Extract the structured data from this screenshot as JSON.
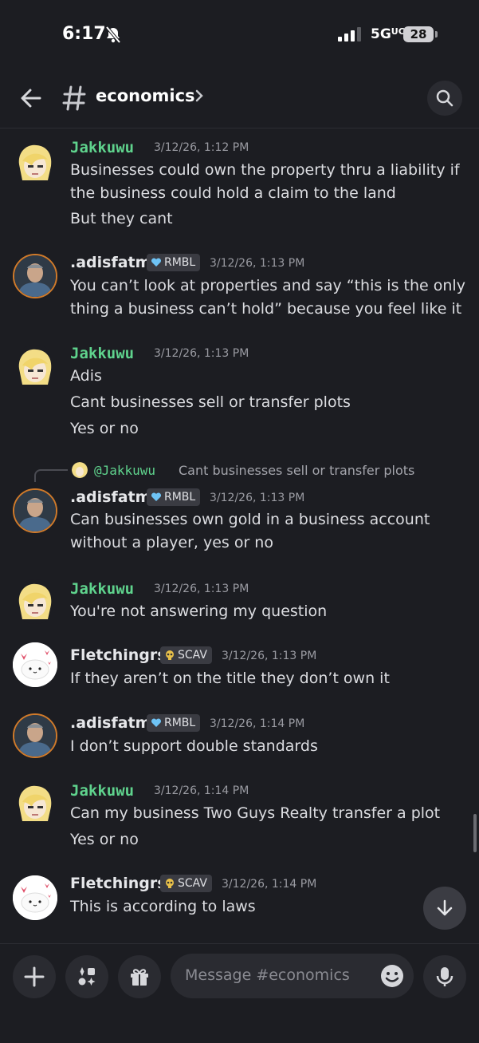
{
  "status_bar": {
    "time": "6:17",
    "network": "5G",
    "network_sub": "UC",
    "battery": "28"
  },
  "header": {
    "channel": "economics"
  },
  "composer": {
    "placeholder": "Message #economics"
  },
  "colors": {
    "background": "#1c1d22",
    "green_name": "#5fd38d",
    "text": "#dcdde1",
    "timestamp": "#9a9ba2"
  },
  "messages": [
    {
      "author": "Jakkuwu",
      "timestamp": "3/12/26, 1:12 PM",
      "lines": [
        "Businesses could own the property thru a liability if",
        "the business could hold a claim to the land",
        "But they cant"
      ]
    },
    {
      "author": ".adisfatm",
      "badge": "RMBL",
      "timestamp": "3/12/26, 1:13 PM",
      "lines": [
        "You can’t look at properties and say “this is the only",
        "thing a business can’t hold” because you feel like it"
      ]
    },
    {
      "author": "Jakkuwu",
      "timestamp": "3/12/26, 1:13 PM",
      "lines": [
        "Adis",
        "Cant businesses sell or transfer plots",
        "Yes or no"
      ]
    },
    {
      "reply": {
        "mention": "@Jakkuwu",
        "text": "Cant businesses sell or transfer plots"
      },
      "author": ".adisfatm",
      "badge": "RMBL",
      "timestamp": "3/12/26, 1:13 PM",
      "lines": [
        "Can businesses own gold in a business account",
        "without a player, yes or no"
      ]
    },
    {
      "author": "Jakkuwu",
      "timestamp": "3/12/26, 1:13 PM",
      "lines": [
        "You're not answering my question"
      ]
    },
    {
      "author": "Fletchingrs",
      "badge": "SCAV",
      "timestamp": "3/12/26, 1:13 PM",
      "lines": [
        "If they aren’t on the title they don’t own it"
      ]
    },
    {
      "author": ".adisfatm",
      "badge": "RMBL",
      "timestamp": "3/12/26, 1:14 PM",
      "lines": [
        "I don’t support double standards"
      ]
    },
    {
      "author": "Jakkuwu",
      "timestamp": "3/12/26, 1:14 PM",
      "lines": [
        "Can my business Two Guys Realty transfer a plot",
        "Yes or no"
      ]
    },
    {
      "author": "Fletchingrs",
      "badge": "SCAV",
      "timestamp": "3/12/26, 1:14 PM",
      "lines": [
        "This is according to laws"
      ]
    }
  ]
}
